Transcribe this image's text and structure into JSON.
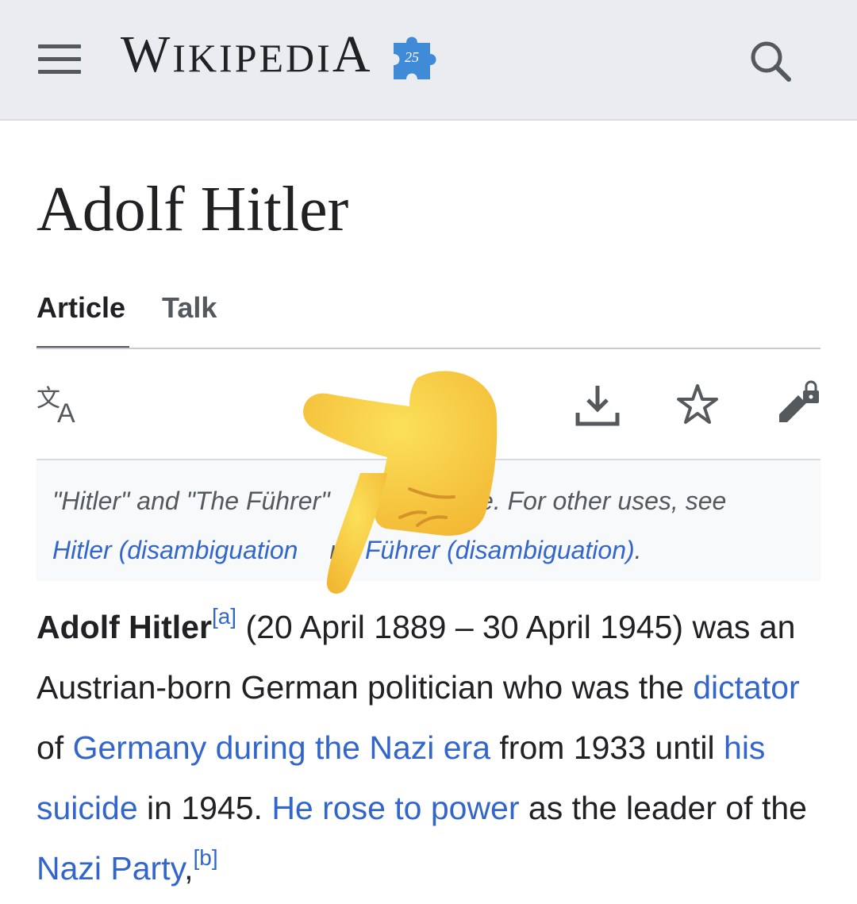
{
  "header": {
    "wordmark_first": "W",
    "wordmark_rest": "IKIPEDI",
    "wordmark_last": "A",
    "badge_number": "25",
    "icons": [
      "menu-icon",
      "wikipedia-25-puzzle-icon",
      "search-icon"
    ]
  },
  "article": {
    "title": "Adolf Hitler",
    "tabs": [
      {
        "label": "Article",
        "active": true
      },
      {
        "label": "Talk",
        "active": false
      }
    ]
  },
  "toolbar": {
    "icons": [
      "language-icon",
      "download-icon",
      "watch-star-icon",
      "edit-locked-icon"
    ]
  },
  "hatnote": {
    "text_1": "\"Hitler\" and \"The Führer\"",
    "text_2": "ere. For other uses, see",
    "link_1": "Hitler (disambiguation",
    "text_3": "nd",
    "link_2": "Führer (disambiguation)",
    "text_4": "."
  },
  "lead": {
    "bold_name": "Adolf Hitler",
    "ref_a": "[a]",
    "t1": " (20 April 1889 – 30 April 1945) was an Austrian-born German politician who was the ",
    "link_dictator": "dictator",
    "t2": " of ",
    "link_germany": "Germany during the Nazi era",
    "t3": " from 1933 until ",
    "link_suicide": "his suicide",
    "t4": " in 1945. ",
    "link_power": "He rose to power",
    "t5": " as the leader of the ",
    "link_party": "Nazi Party",
    "t6": ",",
    "ref_b": "[b]"
  },
  "overlay": {
    "icon": "pointing-hand-emoji-icon"
  },
  "colors": {
    "link": "#3366cc",
    "header_bg": "#eaecf0",
    "hatnote_bg": "#f8f9fa",
    "text": "#202122",
    "emoji": "#f7c843"
  }
}
